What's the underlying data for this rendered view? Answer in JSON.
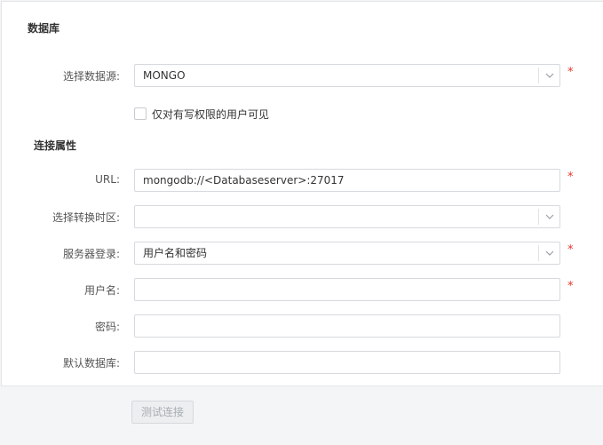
{
  "section": {
    "database_title": "数据库",
    "connection_title": "连接属性"
  },
  "form": {
    "datasource": {
      "label": "选择数据源:",
      "value": "MONGO",
      "required": true
    },
    "visibility_checkbox": {
      "label": "仅对有写权限的用户可见",
      "checked": false
    },
    "url": {
      "label": "URL:",
      "value": "mongodb://<Databaseserver>:27017",
      "required": true
    },
    "timezone": {
      "label": "选择转换时区:",
      "value": "",
      "required": false
    },
    "server_login": {
      "label": "服务器登录:",
      "value": "用户名和密码",
      "required": true
    },
    "username": {
      "label": "用户名:",
      "value": "",
      "required": true
    },
    "password": {
      "label": "密码:",
      "value": "",
      "required": false
    },
    "default_db": {
      "label": "默认数据库:",
      "value": "",
      "required": false
    }
  },
  "required_mark": "*",
  "actions": {
    "test_connection_label": "测试连接",
    "test_connection_disabled": true
  },
  "colors": {
    "required": "#e5352b",
    "border": "#d6d9dd",
    "page_bg": "#f4f5f7"
  }
}
